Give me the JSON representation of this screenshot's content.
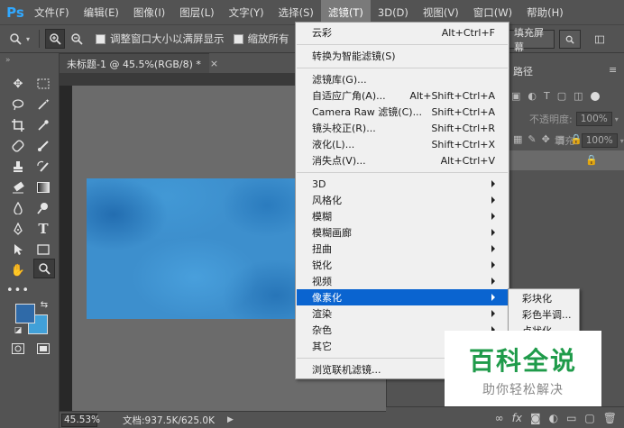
{
  "app": {
    "logo": "Ps"
  },
  "menubar": {
    "items": [
      "文件(F)",
      "编辑(E)",
      "图像(I)",
      "图层(L)",
      "文字(Y)",
      "选择(S)",
      "滤镜(T)",
      "3D(D)",
      "视图(V)",
      "窗口(W)",
      "帮助(H)"
    ],
    "active": "滤镜(T)"
  },
  "options_bar": {
    "checkbox_resize_windows": "调整窗口大小以满屏显示",
    "checkbox_zoom_all": "缩放所有",
    "fill_screen_button": "填充屏幕"
  },
  "document": {
    "tab_title": "未标题-1 @ 45.5%(RGB/8) *",
    "tab_close": "×"
  },
  "status": {
    "zoom": "45.53%",
    "doc_size": "文档:937.5K/625.0K"
  },
  "right_panel": {
    "tab_partial": "路径",
    "opacity_label": "不透明度:",
    "opacity_value": "100%",
    "fill_label": "填充:",
    "fill_value": "100%"
  },
  "filter_menu": {
    "items": [
      {
        "label": "云彩",
        "shortcut": "Alt+Ctrl+F"
      },
      {
        "label": "转换为智能滤镜(S)"
      },
      {
        "label": "滤镜库(G)..."
      },
      {
        "label": "自适应广角(A)...",
        "shortcut": "Alt+Shift+Ctrl+A"
      },
      {
        "label": "Camera Raw 滤镜(C)...",
        "shortcut": "Shift+Ctrl+A"
      },
      {
        "label": "镜头校正(R)...",
        "shortcut": "Shift+Ctrl+R"
      },
      {
        "label": "液化(L)...",
        "shortcut": "Shift+Ctrl+X"
      },
      {
        "label": "消失点(V)...",
        "shortcut": "Alt+Ctrl+V"
      },
      {
        "label": "3D"
      },
      {
        "label": "风格化"
      },
      {
        "label": "模糊"
      },
      {
        "label": "模糊画廊"
      },
      {
        "label": "扭曲"
      },
      {
        "label": "锐化"
      },
      {
        "label": "视频"
      },
      {
        "label": "像素化"
      },
      {
        "label": "渲染"
      },
      {
        "label": "杂色"
      },
      {
        "label": "其它"
      },
      {
        "label": "浏览联机滤镜..."
      }
    ],
    "highlighted": "像素化"
  },
  "pixelate_submenu": {
    "items": [
      "彩块化",
      "彩色半调...",
      "点状化..."
    ]
  },
  "watermark": {
    "title": "百科全说",
    "subtitle": "助你轻松解决"
  },
  "colors": {
    "foreground": "#2f6aa8",
    "background": "#41a0d8",
    "menu_highlight": "#0a64d0",
    "watermark_green": "#1f9b4a"
  }
}
